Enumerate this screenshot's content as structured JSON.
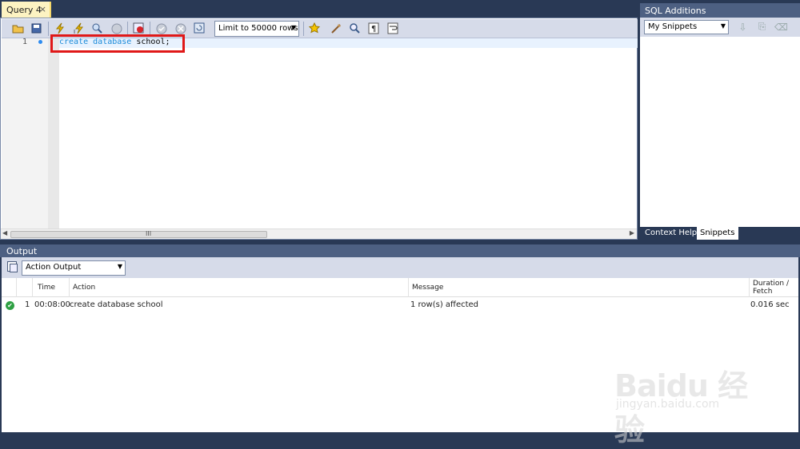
{
  "editor": {
    "tab_title": "Query 4",
    "tab_close": "×",
    "limit_select": "Limit to 50000 rows",
    "line_number": "1",
    "code": {
      "kw1": "create",
      "kw2": "database",
      "ident": "school;"
    }
  },
  "sql_additions": {
    "title": "SQL Additions",
    "snippets_select": "My Snippets",
    "tabs": [
      "Context Help",
      "Snippets"
    ]
  },
  "output": {
    "title": "Output",
    "select": "Action Output",
    "columns": [
      "Time",
      "Action",
      "Message",
      "Duration / Fetch"
    ],
    "rows": [
      {
        "num": "1",
        "time": "00:08:00",
        "action": "create database school",
        "message": "1 row(s) affected",
        "duration": "0.016 sec"
      }
    ]
  },
  "watermark": {
    "text": "Baidu 经验",
    "sub": "jingyan.baidu.com"
  },
  "colors": {
    "chrome": "#293955",
    "panel_title": "#4d6082",
    "toolbar": "#d6dbe9",
    "tab_active": "#fdf3c2",
    "highlight_box": "#e01818",
    "keyword": "#1b8bd9"
  }
}
